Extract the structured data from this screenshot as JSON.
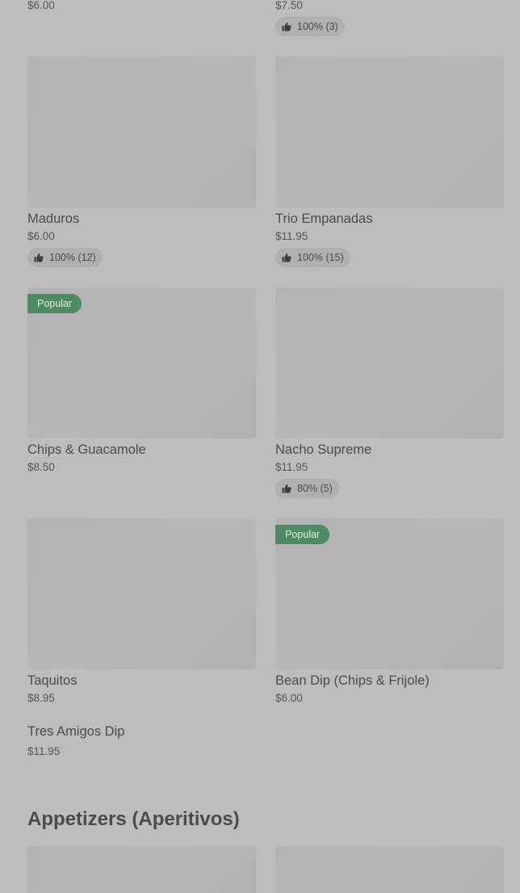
{
  "top_row": {
    "left": {
      "price": "$6.00"
    },
    "right": {
      "price": "$7.50",
      "rating": "100% (3)"
    }
  },
  "items": [
    {
      "name": "Maduros",
      "price": "$6.00",
      "rating": "100% (12)"
    },
    {
      "name": "Trio Empanadas",
      "price": "$11.95",
      "rating": "100% (15)"
    },
    {
      "name": "Chips & Guacamole",
      "price": "$8.50",
      "badge": "Popular"
    },
    {
      "name": "Nacho Supreme",
      "price": "$11.95",
      "rating": "80% (5)"
    },
    {
      "name": "Taquitos",
      "price": "$8.95"
    },
    {
      "name": "Bean Dip (Chips & Frijole)",
      "price": "$6.00",
      "badge": "Popular"
    },
    {
      "name": "Tres Amigos Dip",
      "price": "$11.95"
    }
  ],
  "sections": {
    "appetizers_title": "Appetizers (Aperitivos)"
  },
  "icons": {
    "rating": "thumbs-up-icon"
  },
  "colors": {
    "badge_bg": "#4e8a63",
    "page_bg": "#bdbdbd"
  }
}
